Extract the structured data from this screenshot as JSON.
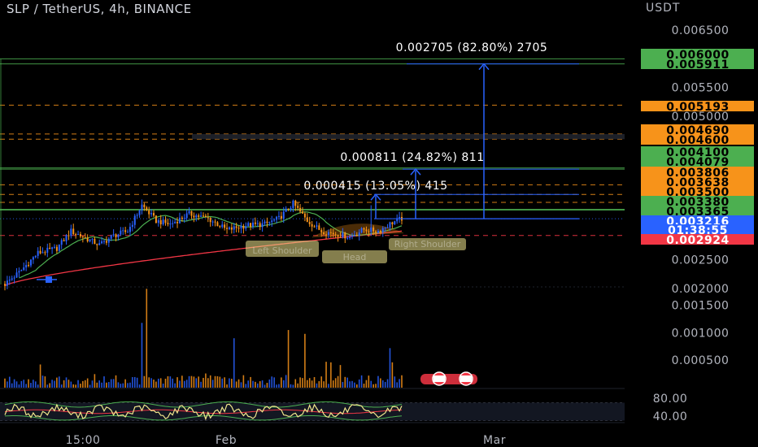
{
  "header": {
    "title": "SLP / TetherUS, 4h, BINANCE",
    "unit": "USDT"
  },
  "chart_data": {
    "type": "candlestick",
    "price_axis": {
      "ylim": [
        0.0019,
        0.0067
      ],
      "ticks": [
        "0.006500",
        "0.006000",
        "0.005500",
        "0.005000",
        "0.003500",
        "0.003000",
        "0.002500",
        "0.002000"
      ]
    },
    "volume_axis": {
      "ylim": [
        0,
        0.00185
      ],
      "ticks": [
        "0.001500",
        "0.001000",
        "0.000500"
      ]
    },
    "rsi_axis": {
      "ylim": [
        23,
        88
      ],
      "ticks": [
        "80.00",
        "40.00"
      ],
      "band": [
        30,
        70
      ]
    },
    "time_axis": {
      "ticks": [
        "15:00",
        "Feb",
        "Mar"
      ]
    },
    "price_labels": [
      {
        "value": 0.006,
        "text": "0.006000",
        "color": "#4caf50"
      },
      {
        "value": 0.005911,
        "text": "0.005911",
        "color": "#4caf50"
      },
      {
        "value": 0.005193,
        "text": "0.005193",
        "color": "#f7931a"
      },
      {
        "value": 0.00469,
        "text": "0.004690",
        "color": "#f7931a"
      },
      {
        "value": 0.0046,
        "text": "0.004600",
        "color": "#f7931a"
      },
      {
        "value": 0.0041,
        "text": "0.004100",
        "color": "#4caf50"
      },
      {
        "value": 0.004079,
        "text": "0.004079",
        "color": "#4caf50"
      },
      {
        "value": 0.003806,
        "text": "0.003806",
        "color": "#f7931a"
      },
      {
        "value": 0.003638,
        "text": "0.003638",
        "color": "#f7931a"
      },
      {
        "value": 0.0035,
        "text": "0.003500",
        "color": "#f7931a"
      },
      {
        "value": 0.00338,
        "text": "0.003380",
        "color": "#4caf50"
      },
      {
        "value": 0.003365,
        "text": "0.003365",
        "color": "#4caf50"
      },
      {
        "value": 0.003216,
        "text": "0.003216",
        "color": "#2962ff"
      },
      {
        "value": 0.003,
        "text": "01:38:55",
        "color": "#2962ff"
      },
      {
        "value": 0.002924,
        "text": "0.002924",
        "color": "#f23645"
      }
    ],
    "measurements": [
      {
        "text": "0.002705 (82.80%) 2705",
        "from": 0.003216,
        "to": 0.005911
      },
      {
        "text": "0.000811 (24.82%) 811",
        "from": 0.003216,
        "to": 0.004079
      },
      {
        "text": "0.000415 (13.05%) 415",
        "from": 0.003216,
        "to": 0.003638
      }
    ],
    "pattern_labels": [
      "Left Shoulder",
      "Head",
      "Right Shoulder"
    ]
  },
  "colors": {
    "up": "#2962ff",
    "down": "#f7931a",
    "support": "#4caf50",
    "resistance": "#f7931a",
    "last": "#2962ff",
    "low": "#f23645",
    "ma_fast": "#4caf50",
    "ma_slow": "#f23645",
    "rsi": "#f0e68c",
    "rsi_band": "#4caf50",
    "rsi_signal": "#f23645"
  }
}
